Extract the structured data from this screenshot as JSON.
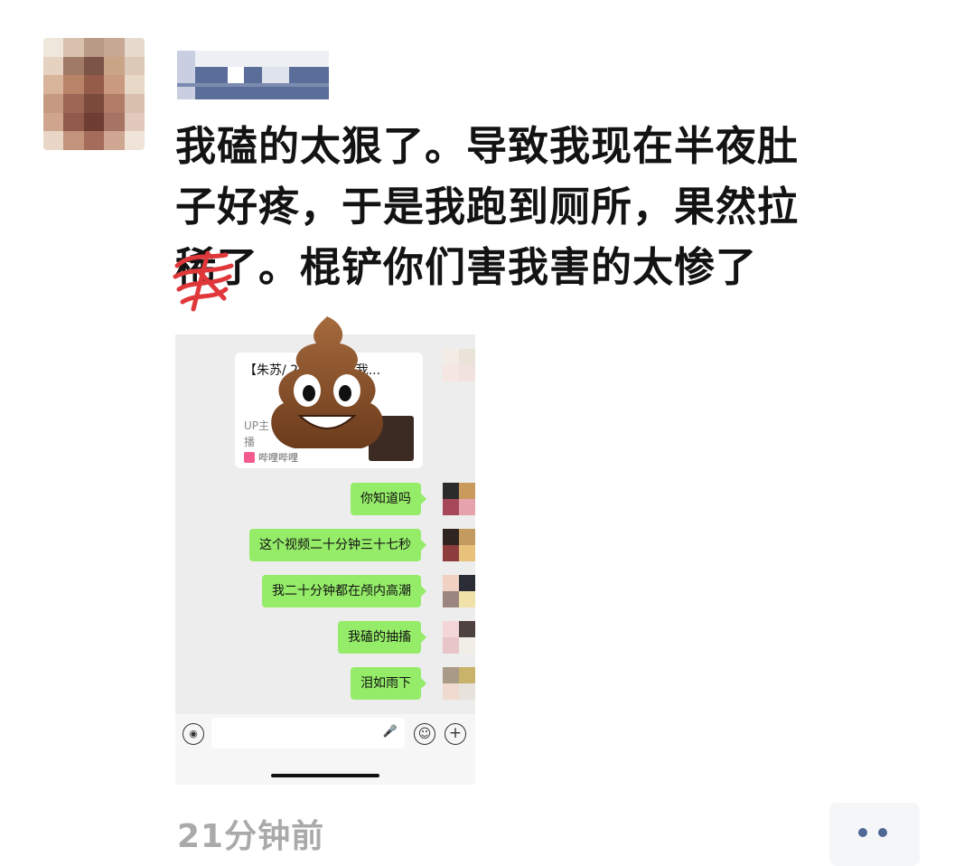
{
  "post": {
    "avatar_icon": "blurred-avatar",
    "username_icon": "blurred-username",
    "text_lines": [
      "我磕的太狠了。导致我现在半夜肚",
      "子好疼，于是我跑到厕所，果然拉",
      "稀了。棍铲你们害我害的太惨了"
    ],
    "timestamp": "21分钟前",
    "more_icon": "more-dots-icon"
  },
  "screenshot": {
    "link_card": {
      "title": "【朱苏/ 2023 年棍 我...",
      "desc_1": "UP主",
      "desc_2": "播",
      "source": "哔哩哔哩"
    },
    "messages": [
      {
        "text": "你知道吗"
      },
      {
        "text": "这个视频二十分钟三十七秒"
      },
      {
        "text": "我二十分钟都在颅内高潮"
      },
      {
        "text": "我磕的抽搐"
      },
      {
        "text": "泪如雨下"
      }
    ],
    "input_bar": {
      "voice_icon": "voice-icon",
      "mic_icon": "mic-icon",
      "emoji_icon": "emoji-icon",
      "plus_icon": "plus-icon"
    }
  },
  "sticker": {
    "icon": "poop-emoji-icon"
  },
  "colors": {
    "bubble": "#95ec69",
    "name_block": "#5b6d99",
    "more_dots": "#4f6896"
  }
}
